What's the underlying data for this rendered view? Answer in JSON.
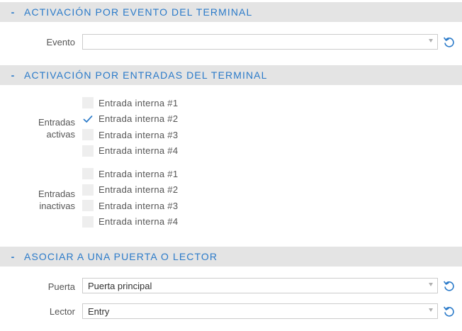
{
  "section_event": {
    "toggle": "-",
    "title": "ACTIVACIÓN POR EVENTO DEL TERMINAL",
    "evento_label": "Evento",
    "evento_value": ""
  },
  "section_inputs": {
    "toggle": "-",
    "title": "ACTIVACIÓN POR ENTRADAS DEL TERMINAL",
    "active_label_line1": "Entradas",
    "active_label_line2": "activas",
    "inactive_label_line1": "Entradas",
    "inactive_label_line2": "inactivas",
    "active_inputs": [
      {
        "label": "Entrada interna #1",
        "checked": false
      },
      {
        "label": "Entrada interna #2",
        "checked": true
      },
      {
        "label": "Entrada interna #3",
        "checked": false
      },
      {
        "label": "Entrada interna #4",
        "checked": false
      }
    ],
    "inactive_inputs": [
      {
        "label": "Entrada interna #1",
        "checked": false
      },
      {
        "label": "Entrada interna #2",
        "checked": false
      },
      {
        "label": "Entrada interna #3",
        "checked": false
      },
      {
        "label": "Entrada interna #4",
        "checked": false
      }
    ]
  },
  "section_door": {
    "toggle": "-",
    "title": "ASOCIAR A UNA PUERTA O LECTOR",
    "puerta_label": "Puerta",
    "puerta_value": "Puerta principal",
    "lector_label": "Lector",
    "lector_value": "Entry"
  },
  "icons": {
    "reset": "undo-arrow-icon",
    "dropdown": "chevron-down-icon",
    "check": "check-icon"
  },
  "colors": {
    "accent": "#2a7ac9",
    "header_bg": "#e4e4e4",
    "checkbox_bg": "#eeeeee"
  }
}
